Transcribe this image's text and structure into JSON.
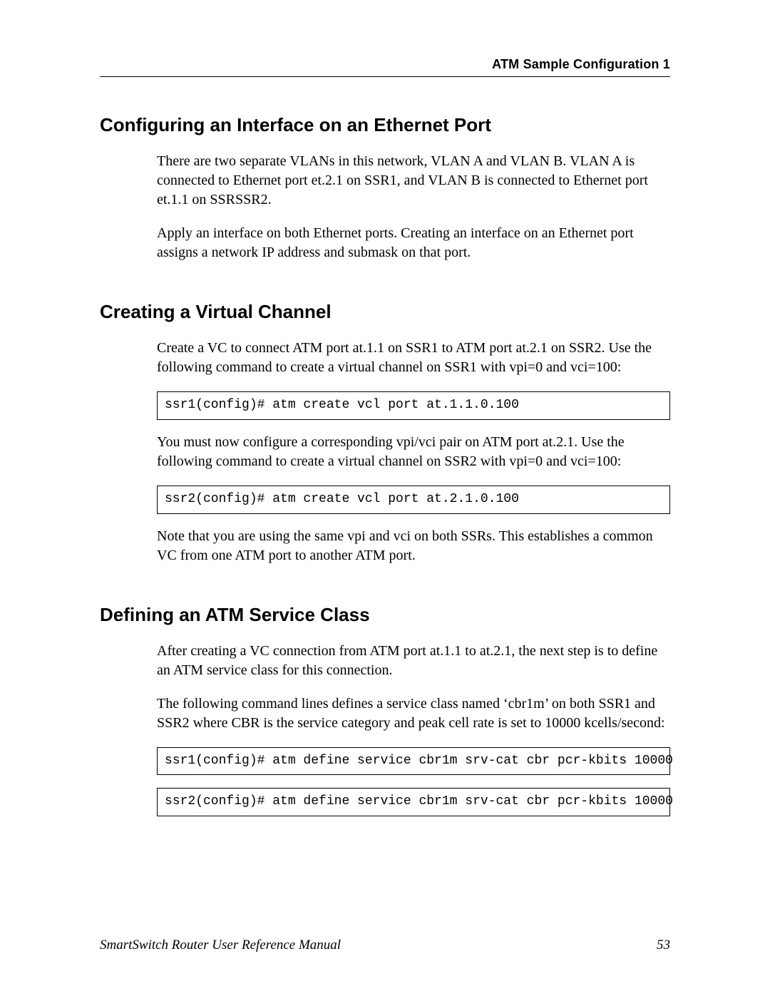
{
  "running_head": "ATM Sample Configuration 1",
  "sections": {
    "s1": {
      "heading": "Configuring an Interface on an Ethernet Port",
      "p1": "There are two separate VLANs in this network, VLAN A and VLAN B. VLAN A is connected to Ethernet port et.2.1 on SSR1, and VLAN B is connected to Ethernet port et.1.1 on SSRSSR2.",
      "p2": "Apply an interface on both Ethernet ports. Creating an interface on an Ethernet port assigns a network IP address and submask on that port."
    },
    "s2": {
      "heading": "Creating a Virtual Channel",
      "p1": "Create a VC to connect ATM port at.1.1 on SSR1 to ATM port at.2.1 on SSR2. Use the following command to create a virtual channel on SSR1 with vpi=0 and vci=100:",
      "code1": "ssr1(config)# atm create vcl port at.1.1.0.100",
      "p2": "You must now configure a corresponding vpi/vci pair on ATM port at.2.1.  Use the following command to create a virtual channel on SSR2 with vpi=0 and vci=100:",
      "code2": "ssr2(config)# atm create vcl port at.2.1.0.100",
      "p3": "Note that you are using the same vpi and vci on both SSRs. This establishes a common VC from one ATM port to another ATM port."
    },
    "s3": {
      "heading": "Defining an ATM Service Class",
      "p1": "After creating a VC connection from ATM port at.1.1 to at.2.1, the next step is to define an ATM service class for this connection.",
      "p2": "The following command lines defines a service class named ‘cbr1m’ on both SSR1 and SSR2 where CBR is the service category and peak cell rate is set to 10000 kcells/second:",
      "code1": "ssr1(config)# atm define service cbr1m srv-cat cbr pcr-kbits 10000",
      "code2": "ssr2(config)# atm define service cbr1m srv-cat cbr pcr-kbits 10000"
    }
  },
  "footer": {
    "manual": "SmartSwitch Router User Reference Manual",
    "page": "53"
  }
}
